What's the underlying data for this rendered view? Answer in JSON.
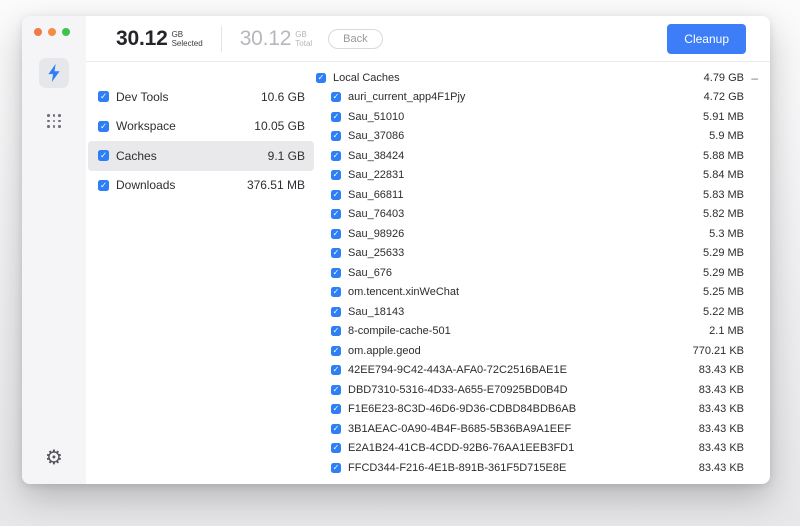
{
  "window": {
    "traffic_lights": [
      "close",
      "minimize",
      "zoom"
    ],
    "header": {
      "selected": {
        "value": "30.12",
        "unit": "GB",
        "label": "Selected"
      },
      "total": {
        "value": "30.12",
        "unit": "GB",
        "label": "Total"
      },
      "back_label": "Back",
      "cleanup_label": "Cleanup"
    }
  },
  "sidebar": {
    "tools": [
      {
        "icon": "lightning-icon",
        "active": true
      },
      {
        "icon": "grid-icon",
        "active": false
      }
    ],
    "settings_icon": "gear-icon"
  },
  "categories": [
    {
      "label": "Dev Tools",
      "size": "10.6 GB",
      "checked": true,
      "selected": false
    },
    {
      "label": "Workspace",
      "size": "10.05 GB",
      "checked": true,
      "selected": false
    },
    {
      "label": "Caches",
      "size": "9.1 GB",
      "checked": true,
      "selected": true
    },
    {
      "label": "Downloads",
      "size": "376.51 MB",
      "checked": true,
      "selected": false
    }
  ],
  "file_list": {
    "group": {
      "label": "Local Caches",
      "size": "4.79 GB",
      "checked": true,
      "collapse_indicator": "–"
    },
    "items": [
      {
        "label": "auri_current_app4F1Pjy",
        "size": "4.72 GB",
        "checked": true
      },
      {
        "label": "Sau_51010",
        "size": "5.91 MB",
        "checked": true
      },
      {
        "label": "Sau_37086",
        "size": "5.9 MB",
        "checked": true
      },
      {
        "label": "Sau_38424",
        "size": "5.88 MB",
        "checked": true
      },
      {
        "label": "Sau_22831",
        "size": "5.84 MB",
        "checked": true
      },
      {
        "label": "Sau_66811",
        "size": "5.83 MB",
        "checked": true
      },
      {
        "label": "Sau_76403",
        "size": "5.82 MB",
        "checked": true
      },
      {
        "label": "Sau_98926",
        "size": "5.3 MB",
        "checked": true
      },
      {
        "label": "Sau_25633",
        "size": "5.29 MB",
        "checked": true
      },
      {
        "label": "Sau_676",
        "size": "5.29 MB",
        "checked": true
      },
      {
        "label": "om.tencent.xinWeChat",
        "size": "5.25 MB",
        "checked": true
      },
      {
        "label": "Sau_18143",
        "size": "5.22 MB",
        "checked": true
      },
      {
        "label": "8-compile-cache-501",
        "size": "2.1 MB",
        "checked": true
      },
      {
        "label": "om.apple.geod",
        "size": "770.21 KB",
        "checked": true
      },
      {
        "label": "42EE794-9C42-443A-AFA0-72C2516BAE1E",
        "size": "83.43 KB",
        "checked": true
      },
      {
        "label": "DBD7310-5316-4D33-A655-E70925BD0B4D",
        "size": "83.43 KB",
        "checked": true
      },
      {
        "label": "F1E6E23-8C3D-46D6-9D36-CDBD84BDB6AB",
        "size": "83.43 KB",
        "checked": true
      },
      {
        "label": "3B1AEAC-0A90-4B4F-B685-5B36BA9A1EEF",
        "size": "83.43 KB",
        "checked": true
      },
      {
        "label": "E2A1B24-41CB-4CDD-92B6-76AA1EEB3FD1",
        "size": "83.43 KB",
        "checked": true
      },
      {
        "label": "FFCD344-F216-4E1B-891B-361F5D715E8E",
        "size": "83.43 KB",
        "checked": true
      }
    ]
  },
  "colors": {
    "accent_blue": "#3d7ef8",
    "checkbox_blue": "#2e7ef5",
    "selected_row_bg": "#e9e9eb",
    "rail_bg": "#f5f5f7"
  }
}
